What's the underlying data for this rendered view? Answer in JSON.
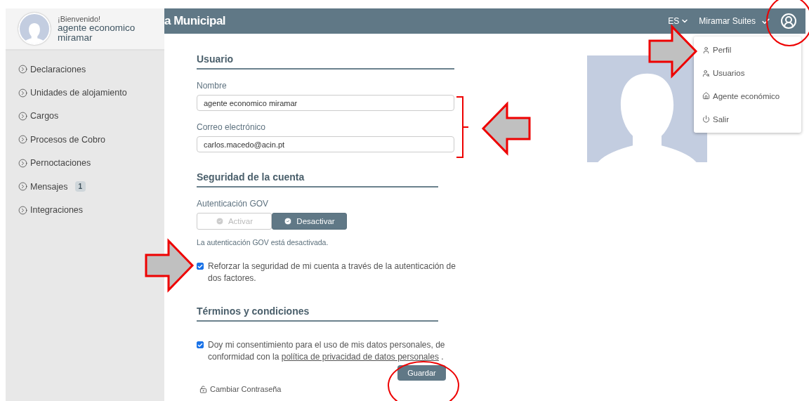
{
  "header": {
    "title": "a Municipal",
    "language": "ES",
    "account": "Miramar Suites"
  },
  "sidebar": {
    "greeting": "¡Bienvenido!",
    "user_name": "agente economico miramar",
    "items": [
      {
        "label": "Declaraciones"
      },
      {
        "label": "Unidades de alojamiento"
      },
      {
        "label": "Cargos"
      },
      {
        "label": "Procesos de Cobro"
      },
      {
        "label": "Pernoctaciones"
      },
      {
        "label": "Mensajes",
        "badge": "1"
      },
      {
        "label": "Integraciones"
      }
    ]
  },
  "user_menu": {
    "items": [
      {
        "label": "Perfil",
        "kind": "profile"
      },
      {
        "label": "Usuarios",
        "kind": "users"
      },
      {
        "label": "Agente económico",
        "kind": "home"
      },
      {
        "label": "Salir",
        "kind": "logout"
      }
    ]
  },
  "user_section": {
    "title": "Usuario",
    "fields": [
      {
        "label": "Nombre",
        "value": "agente economico miramar"
      },
      {
        "label": "Correo electrónico",
        "value": "carlos.macedo@acin.pt"
      }
    ]
  },
  "security_section": {
    "title": "Seguridad de la cuenta",
    "toggle_label": "Autenticación GOV",
    "options": [
      {
        "label": "Activar",
        "selected": false
      },
      {
        "label": "Desactivar",
        "selected": true
      }
    ],
    "note": "La autenticación GOV está desactivada.",
    "two_factor": {
      "label": "Reforzar la seguridad de mi cuenta a través de la autenticación de dos factores.",
      "checked": true
    }
  },
  "terms_section": {
    "title": "Términos y condiciones",
    "consent": {
      "text": "Doy mi consentimiento para el uso de mis datos personales, de conformidad con la",
      "link": "política de privacidad de datos personales",
      "after": " .",
      "checked": true
    }
  },
  "save_button": "Guardar",
  "change_password": "Cambiar Contraseña"
}
